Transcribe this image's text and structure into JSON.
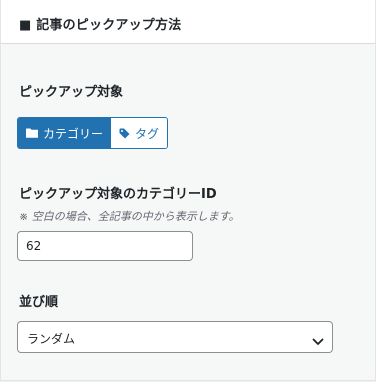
{
  "panel": {
    "title": "■ 記事のピックアップ方法"
  },
  "pickup_target": {
    "label": "ピックアップ対象",
    "options": [
      {
        "label": "カテゴリー",
        "icon": "folder-icon",
        "selected": true
      },
      {
        "label": "タグ",
        "icon": "tag-icon",
        "selected": false
      }
    ]
  },
  "category_id": {
    "label": "ピックアップ対象のカテゴリーID",
    "hint": "※ 空白の場合、全記事の中から表示します。",
    "value": "62"
  },
  "order": {
    "label": "並び順",
    "selected": "ランダム"
  },
  "colors": {
    "accent": "#2271b1",
    "background": "#f6f7f7"
  }
}
